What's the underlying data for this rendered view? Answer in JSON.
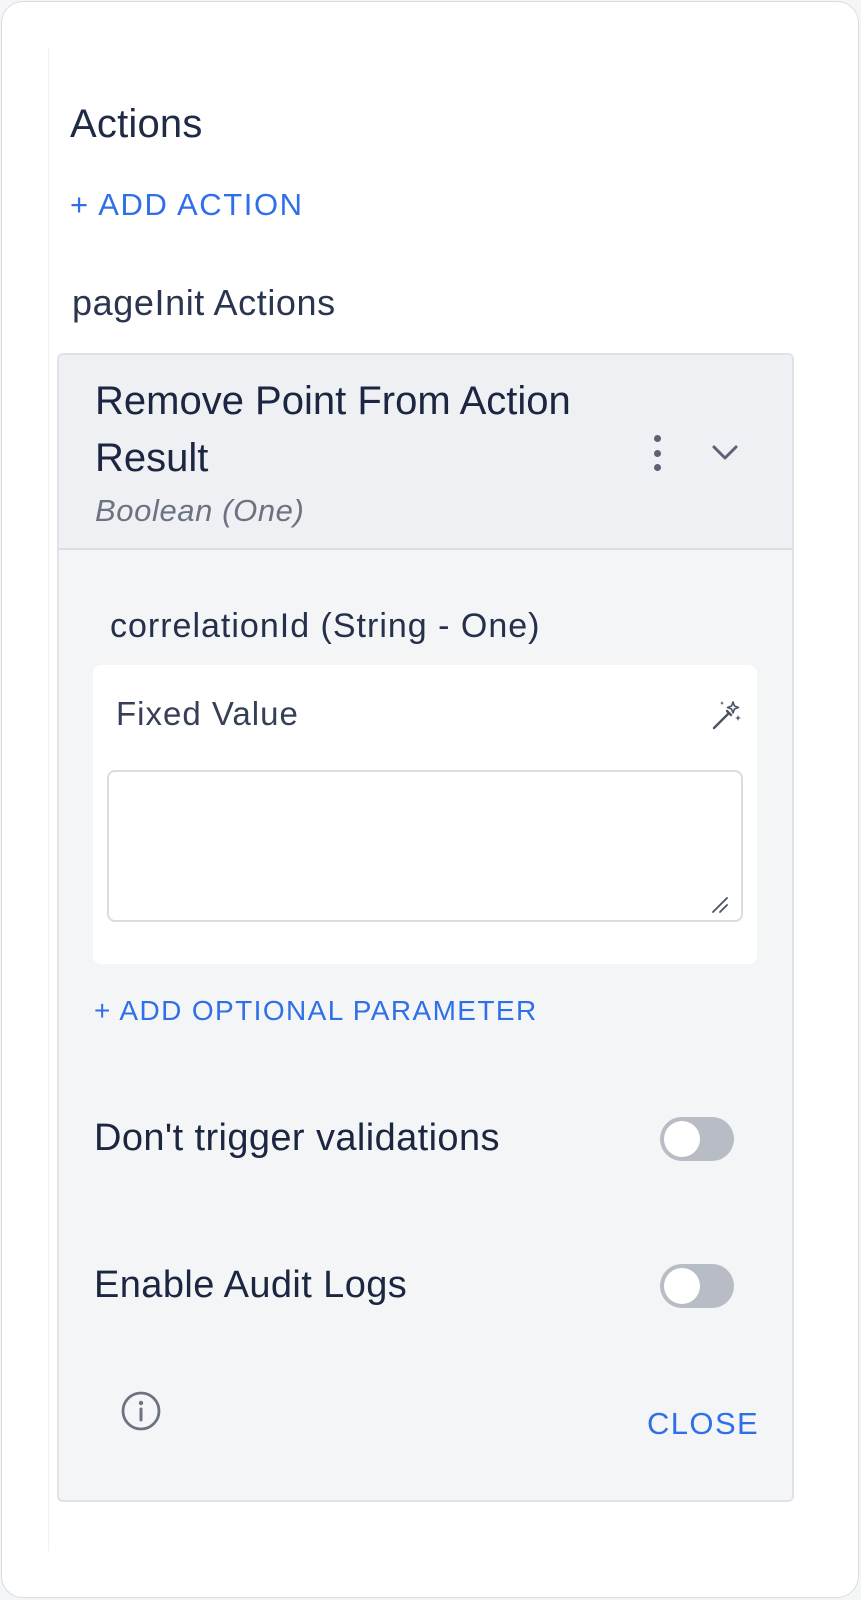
{
  "actions": {
    "title": "Actions",
    "add_action_label": "+ ADD ACTION",
    "group_title": "pageInit Actions"
  },
  "action_card": {
    "title": "Remove Point From Action Result",
    "subtitle": "Boolean (One)",
    "kebab_icon": "more-vertical-icon",
    "chevron_icon": "chevron-down-icon"
  },
  "parameter": {
    "label": "correlationId (String - One)",
    "mode_label": "Fixed Value",
    "mode_icon": "magic-wand-icon",
    "value": "",
    "add_optional_label": "+ ADD OPTIONAL PARAMETER"
  },
  "options": {
    "dont_trigger_validations": {
      "label": "Don't trigger validations",
      "enabled": false
    },
    "enable_audit_logs": {
      "label": "Enable Audit Logs",
      "enabled": false
    }
  },
  "footer": {
    "info_icon": "info-icon",
    "close_label": "CLOSE"
  },
  "colors": {
    "accent": "#2f6fe8",
    "toggle_off": "#b7bcc5",
    "card_background": "#f4f5f7"
  }
}
